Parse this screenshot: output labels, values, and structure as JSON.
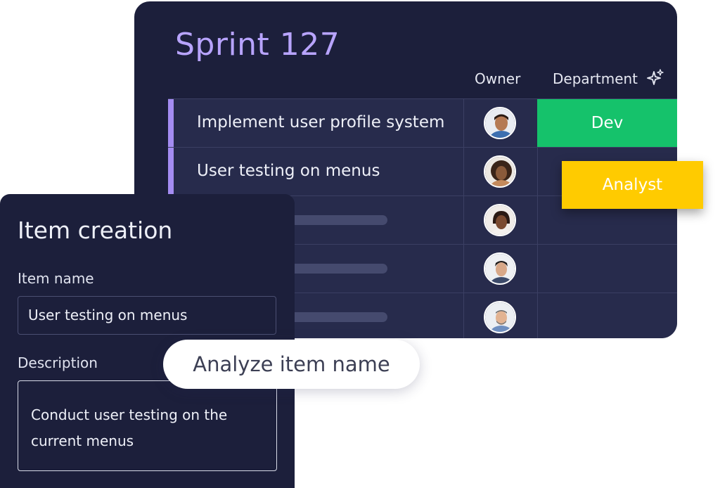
{
  "board": {
    "title": "Sprint 127",
    "columns": {
      "owner": "Owner",
      "department": "Department"
    },
    "rows": [
      {
        "item": "Implement user profile system",
        "department": "Dev"
      },
      {
        "item": "User testing on menus",
        "department": ""
      },
      {
        "item": "",
        "department": ""
      },
      {
        "item": "",
        "department": ""
      },
      {
        "item": "",
        "department": ""
      }
    ],
    "floating_tag": "Analyst",
    "colors": {
      "accent": "#a48cf2",
      "dev": "#15c26b",
      "analyst": "#ffcb00",
      "panel": "#1c1f3b"
    }
  },
  "creation": {
    "title": "Item creation",
    "name_label": "Item name",
    "name_value": "User testing on menus",
    "description_label": "Description",
    "description_value": "Conduct user testing on the current menus"
  },
  "action": {
    "label": "Analyze item name"
  }
}
